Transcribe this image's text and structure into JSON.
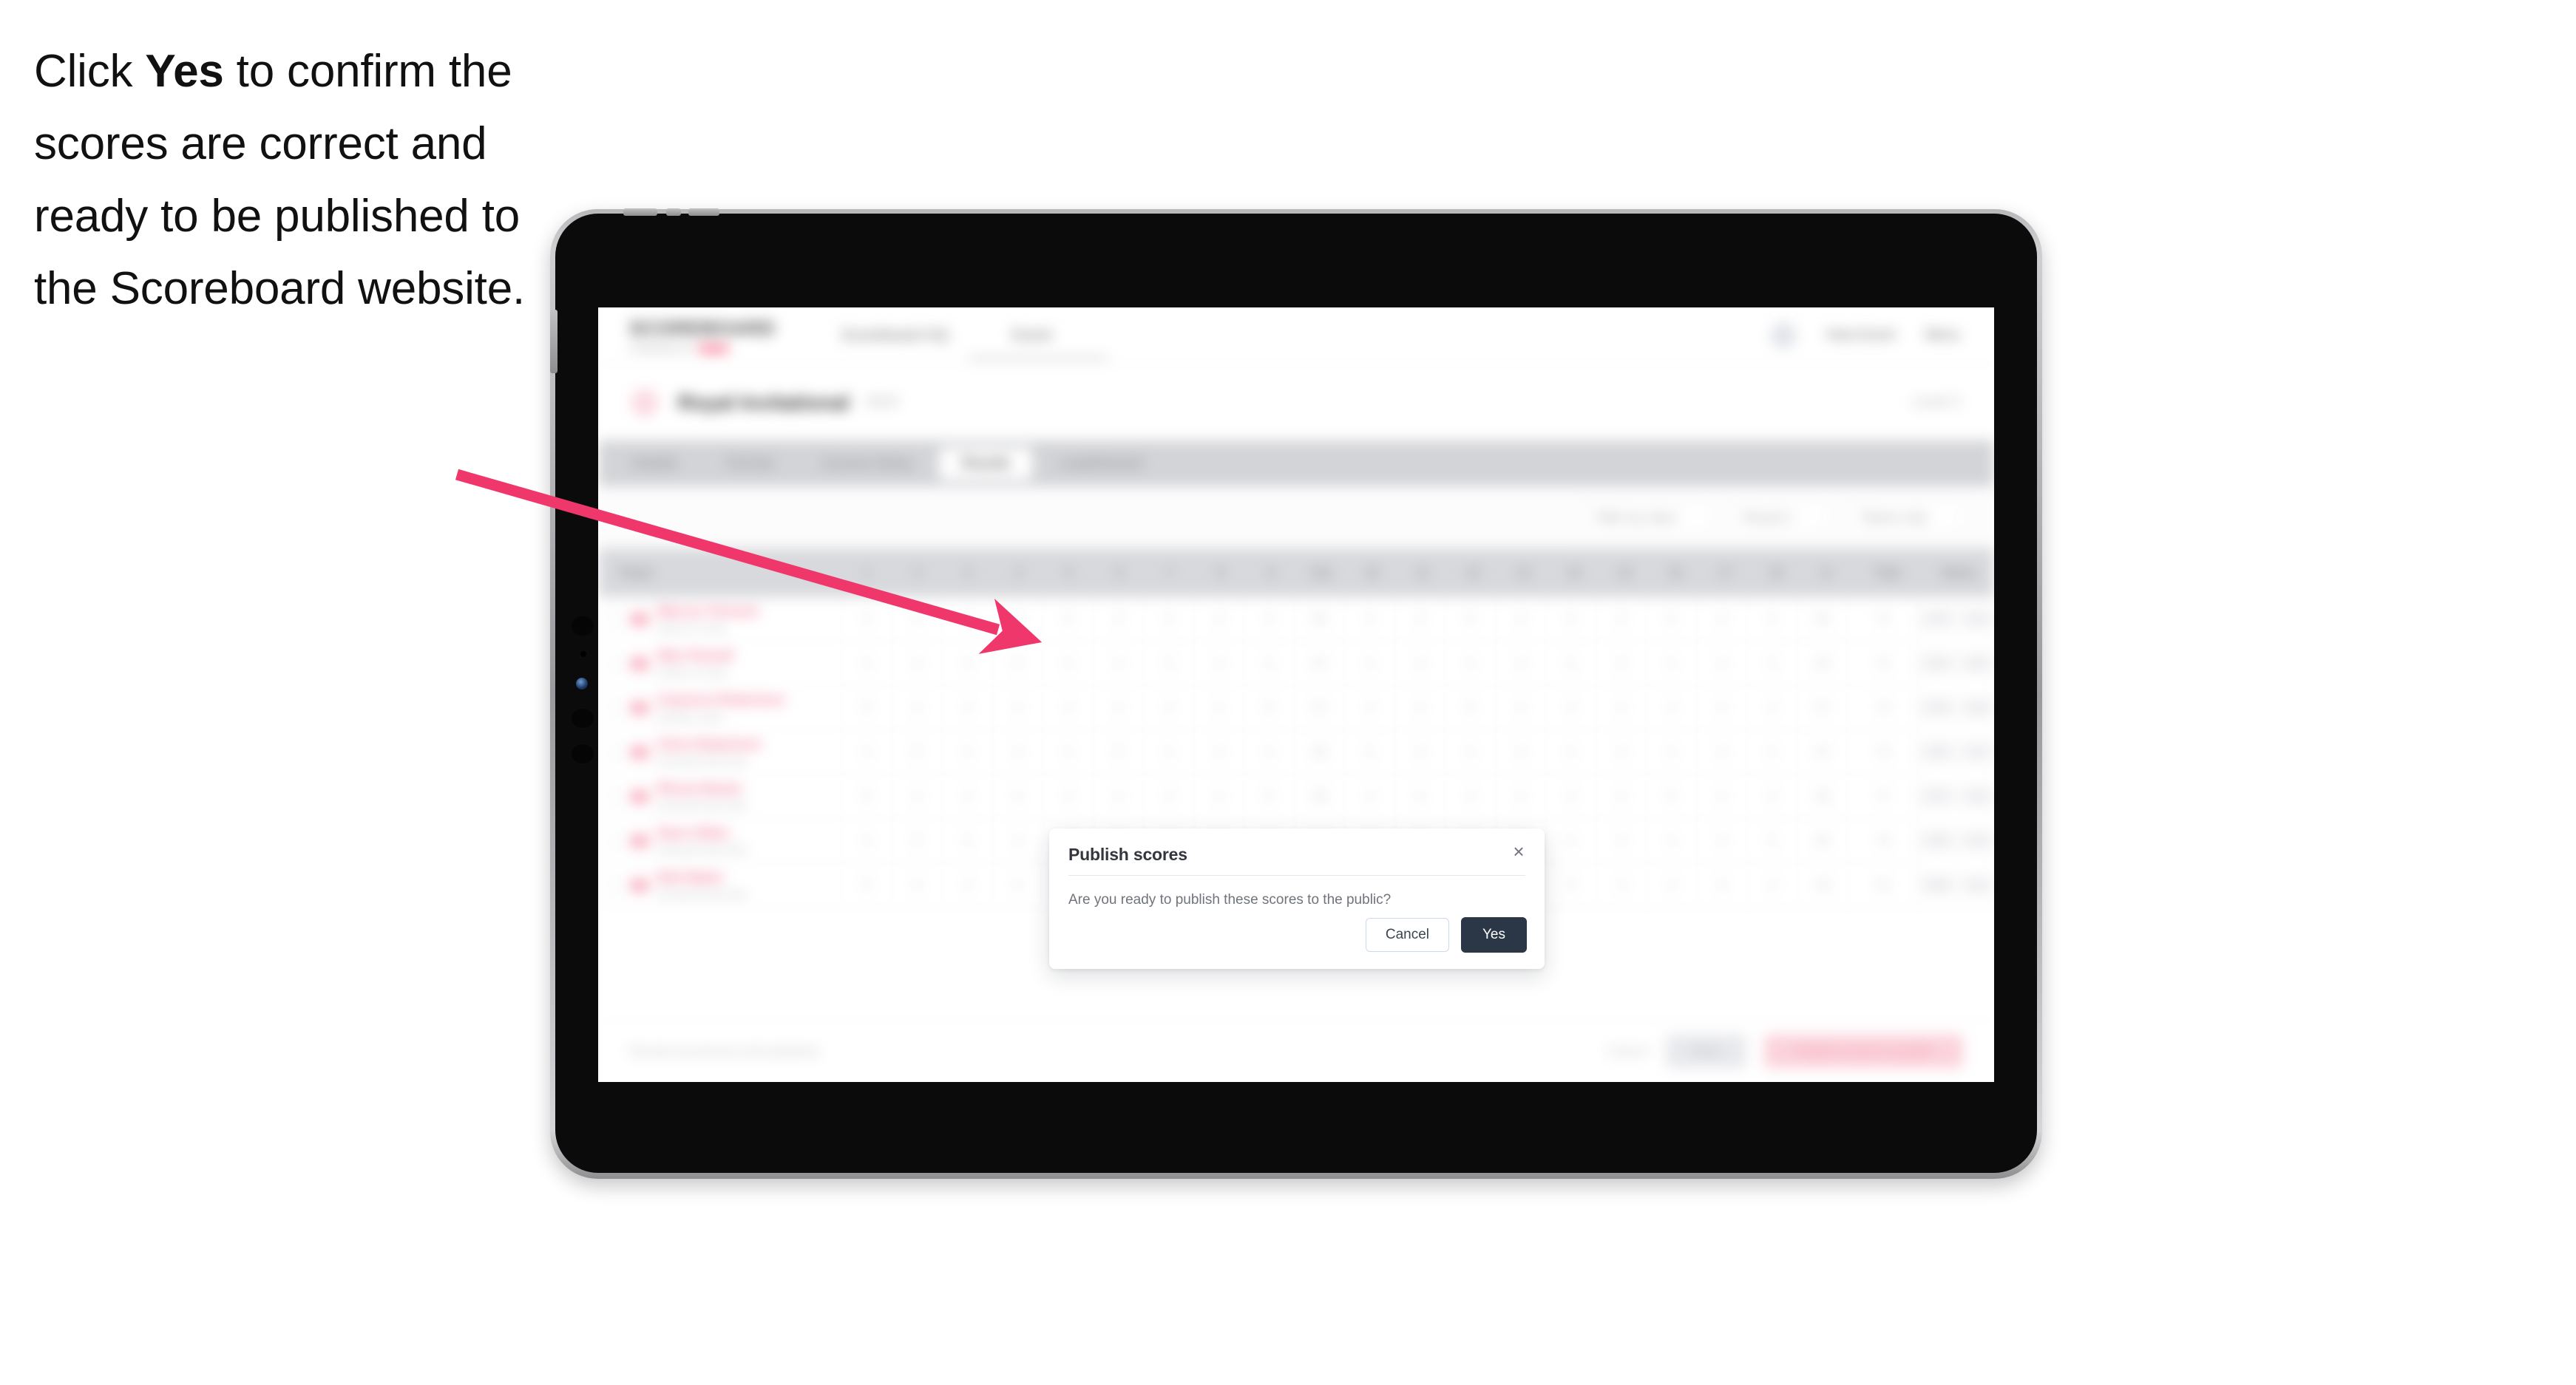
{
  "caption": {
    "before": "Click ",
    "emphasis": "Yes",
    "after": " to confirm the scores are correct and ready to be published to the Scoreboard website."
  },
  "colors": {
    "accent_pink": "#f0376b",
    "brand_pink": "#f4476d",
    "primary_dark": "#2b3646",
    "cancel_border": "#cdd9ef",
    "device_black": "#0b0b0c",
    "device_rim": "#b8b8bb"
  },
  "device": {
    "kind": "tablet",
    "orientation": "landscape"
  },
  "app": {
    "topbar": {
      "brand_word": "SCOREBOARD",
      "brand_sub_text": "POWERED BY",
      "nav_links": [
        "Scoreboard HQ",
        "Event"
      ],
      "right_links": [
        "View Event",
        "Menu"
      ]
    },
    "event": {
      "name": "Royal Invitational",
      "meta": "2024",
      "right_meta": "Level 3"
    },
    "tabs": [
      {
        "label": "Details",
        "active": false
      },
      {
        "label": "Format",
        "active": false
      },
      {
        "label": "Course Setup",
        "active": false
      },
      {
        "label": "Results",
        "active": true
      },
      {
        "label": "Leaderboard",
        "active": false
      }
    ],
    "filters": [
      {
        "label": "Filter by class",
        "chevron": "⌄"
      },
      {
        "label": "Round 1",
        "chevron": "⌄"
      },
      {
        "label": "Teams only",
        "chevron": "⌄"
      }
    ],
    "table": {
      "columns": [
        "Player",
        "1",
        "2",
        "3",
        "4",
        "5",
        "6",
        "7",
        "8",
        "9",
        "Out",
        "10",
        "11",
        "12",
        "13",
        "14",
        "15",
        "16",
        "17",
        "18",
        "In",
        "Total",
        "Status"
      ],
      "rows": [
        {
          "name": "Marcus Tennent",
          "club": "Hazel Ct Club",
          "scores": [
            "4",
            "5",
            "3",
            "4",
            "5",
            "3",
            "4",
            "4",
            "4"
          ],
          "out": "36",
          "scores_in": [
            "4",
            "3",
            "5",
            "4",
            "4",
            "3",
            "5",
            "4",
            "4"
          ],
          "in": "36",
          "total": "72",
          "status_a": "+72",
          "status_b": "-20"
        },
        {
          "name": "Wyn Parnell",
          "club": "Hazel Ct Club",
          "scores": [
            "4",
            "4",
            "4",
            "5",
            "4",
            "4",
            "3",
            "4",
            "5"
          ],
          "out": "37",
          "scores_in": [
            "4",
            "4",
            "4",
            "4",
            "5",
            "3",
            "4",
            "4",
            "3"
          ],
          "in": "35",
          "total": "72",
          "status_a": "+72",
          "status_b": "-20"
        },
        {
          "name": "Cameron Robertson",
          "club": "Dunbar Links",
          "scores": [
            "5",
            "4",
            "4",
            "4",
            "4",
            "4",
            "4",
            "3",
            "5"
          ],
          "out": "37",
          "scores_in": [
            "4",
            "4",
            "5",
            "4",
            "4",
            "4",
            "4",
            "4",
            "4"
          ],
          "in": "37",
          "total": "74",
          "status_a": "+74",
          "status_b": "-18"
        },
        {
          "name": "Chris Robertson",
          "club": "Kinnoull Golf Club",
          "scores": [
            "4",
            "5",
            "4",
            "4",
            "4",
            "5",
            "4",
            "4",
            "4"
          ],
          "out": "38",
          "scores_in": [
            "5",
            "4",
            "4",
            "4",
            "4",
            "4",
            "4",
            "4",
            "4"
          ],
          "in": "37",
          "total": "75",
          "status_a": "+75",
          "status_b": "-17"
        },
        {
          "name": "Rhona Bowie",
          "club": "Kinnoull Golf Club",
          "scores": [
            "5",
            "4",
            "4",
            "5",
            "4",
            "4",
            "4",
            "4",
            "5"
          ],
          "out": "39",
          "scores_in": [
            "4",
            "5",
            "4",
            "4",
            "4",
            "4",
            "5",
            "4",
            "4"
          ],
          "in": "38",
          "total": "77",
          "status_a": "+77",
          "status_b": "-15"
        },
        {
          "name": "Dave Gillen",
          "club": "Kinnoull Golf Club",
          "scores": [
            "4",
            "5",
            "5",
            "4",
            "5",
            "4",
            "4",
            "5",
            "4"
          ],
          "out": "40",
          "scores_in": [
            "4",
            "4",
            "5",
            "5",
            "4",
            "4",
            "4",
            "4",
            "5"
          ],
          "in": "39",
          "total": "79",
          "status_a": "+79",
          "status_b": "-13"
        },
        {
          "name": "Bob Baker",
          "club": "Kinnoull Golf Club",
          "scores": [
            "5",
            "5",
            "4",
            "5",
            "4",
            "5",
            "4",
            "4",
            "5"
          ],
          "out": "41",
          "scores_in": [
            "5",
            "4",
            "5",
            "4",
            "5",
            "4",
            "4",
            "5",
            "4"
          ],
          "in": "40",
          "total": "81",
          "status_a": "+81",
          "status_b": "-11"
        }
      ]
    },
    "footer": {
      "note": "Results provisional until published",
      "link": "Cancel",
      "secondary": "Save",
      "primary": "Publish scores to public"
    }
  },
  "modal": {
    "title": "Publish scores",
    "message": "Are you ready to publish these scores to the public?",
    "close_icon": "×",
    "cancel_label": "Cancel",
    "yes_label": "Yes"
  }
}
